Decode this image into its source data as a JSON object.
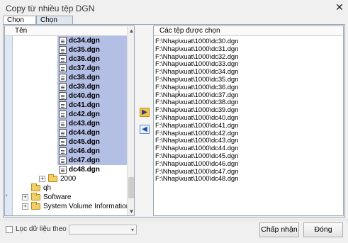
{
  "window": {
    "title": "Copy từ nhiều tệp DGN",
    "close_glyph": "✕"
  },
  "tabs": [
    {
      "label": "Chọn tệp",
      "active": true
    },
    {
      "label": "Chọn Level",
      "active": false
    }
  ],
  "tree": {
    "header": "Tên",
    "files": [
      "dc34.dgn",
      "dc35.dgn",
      "dc36.dgn",
      "dc37.dgn",
      "dc38.dgn",
      "dc39.dgn",
      "dc40.dgn",
      "dc41.dgn",
      "dc42.dgn",
      "dc43.dgn",
      "dc44.dgn",
      "dc45.dgn",
      "dc46.dgn",
      "dc47.dgn",
      "dc48.dgn"
    ],
    "folders": [
      {
        "label": "2000",
        "expander": "+"
      },
      {
        "label": "qh",
        "expander": ""
      },
      {
        "label": "Software",
        "expander": "+"
      },
      {
        "label": "System Volume Information",
        "expander": "+"
      }
    ]
  },
  "middle": {
    "add_glyph": "▶",
    "remove_glyph": "◀"
  },
  "selected_list": {
    "header": "Các tệp được chọn",
    "items": [
      "F:\\Nhap\\xuat\\1000\\dc30.dgn",
      "F:\\Nhap\\xuat\\1000\\dc31.dgn",
      "F:\\Nhap\\xuat\\1000\\dc32.dgn",
      "F:\\Nhap\\xuat\\1000\\dc33.dgn",
      "F:\\Nhap\\xuat\\1000\\dc34.dgn",
      "F:\\Nhap\\xuat\\1000\\dc35.dgn",
      "F:\\Nhap\\xuat\\1000\\dc36.dgn",
      "F:\\Nhap\\xuat\\1000\\dc37.dgn",
      "F:\\Nhap\\xuat\\1000\\dc38.dgn",
      "F:\\Nhap\\xuat\\1000\\dc39.dgn",
      "F:\\Nhap\\xuat\\1000\\dc40.dgn",
      "F:\\Nhap\\xuat\\1000\\dc41.dgn",
      "F:\\Nhap\\xuat\\1000\\dc42.dgn",
      "F:\\Nhap\\xuat\\1000\\dc43.dgn",
      "F:\\Nhap\\xuat\\1000\\dc44.dgn",
      "F:\\Nhap\\xuat\\1000\\dc45.dgn",
      "F:\\Nhap\\xuat\\1000\\dc46.dgn",
      "F:\\Nhap\\xuat\\1000\\dc47.dgn",
      "F:\\Nhap\\xuat\\1000\\dc48.dgn"
    ]
  },
  "footer": {
    "filter_label": "Lọc dữ liệu theo màu",
    "combo_arrow": "▾",
    "ok_label": "Chấp nhận",
    "close_label": "Đóng"
  },
  "colors": {
    "selection": "#b4bfe6",
    "gutter": "#dfe9f5",
    "accent": "#1e4fa8"
  }
}
